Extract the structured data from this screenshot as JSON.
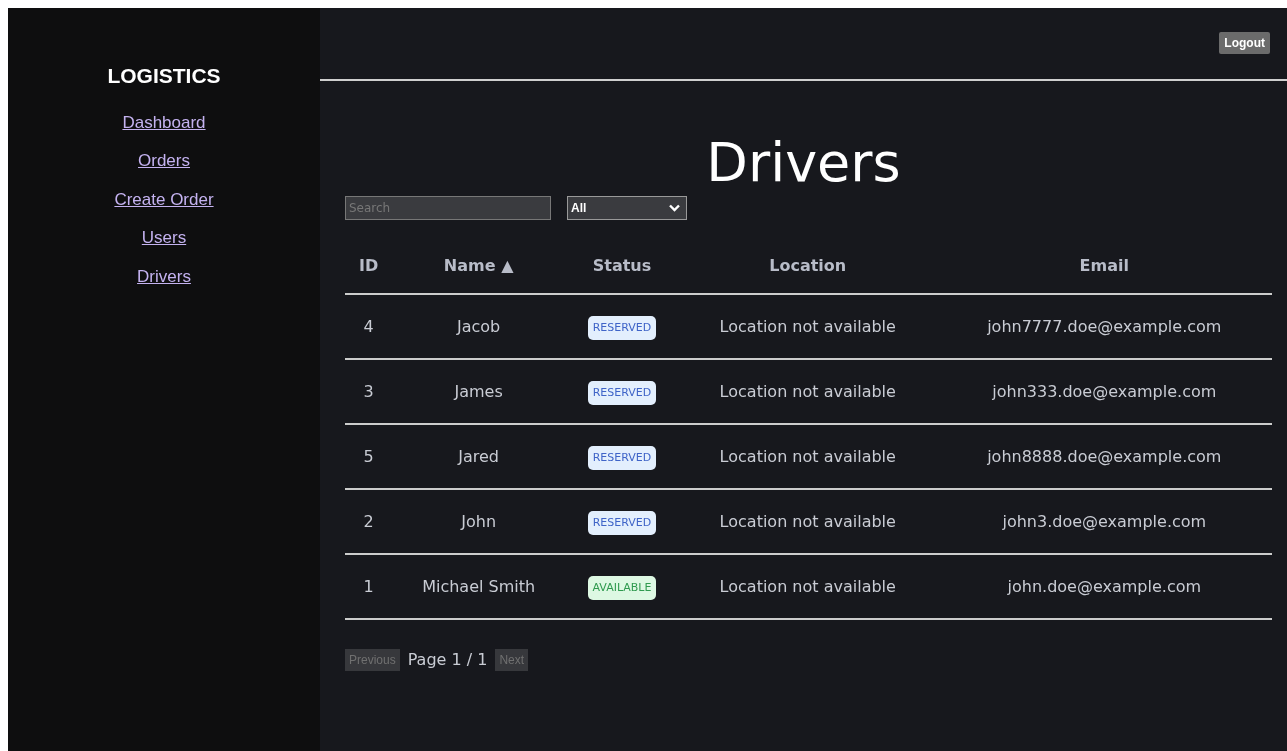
{
  "sidebar": {
    "brand": "LOGISTICS",
    "items": [
      {
        "label": "Dashboard"
      },
      {
        "label": "Orders"
      },
      {
        "label": "Create Order"
      },
      {
        "label": "Users"
      },
      {
        "label": "Drivers"
      }
    ]
  },
  "header": {
    "logout": "Logout"
  },
  "title": "Drivers",
  "filters": {
    "search": {
      "placeholder": "Search"
    },
    "status_select": {
      "value": "All"
    }
  },
  "table": {
    "columns": [
      {
        "label": "ID"
      },
      {
        "label": "Name",
        "sort": "▲"
      },
      {
        "label": "Status"
      },
      {
        "label": "Location"
      },
      {
        "label": "Email"
      }
    ],
    "rows": [
      {
        "id": "4",
        "name": "Jacob",
        "status": {
          "text": "RESERVED",
          "kind": "reserved"
        },
        "location": "Location not available",
        "email": "john7777.doe@example.com"
      },
      {
        "id": "3",
        "name": "James",
        "status": {
          "text": "RESERVED",
          "kind": "reserved"
        },
        "location": "Location not available",
        "email": "john333.doe@example.com"
      },
      {
        "id": "5",
        "name": "Jared",
        "status": {
          "text": "RESERVED",
          "kind": "reserved"
        },
        "location": "Location not available",
        "email": "john8888.doe@example.com"
      },
      {
        "id": "2",
        "name": "John",
        "status": {
          "text": "RESERVED",
          "kind": "reserved"
        },
        "location": "Location not available",
        "email": "john3.doe@example.com"
      },
      {
        "id": "1",
        "name": "Michael Smith",
        "status": {
          "text": "AVAILABLE",
          "kind": "available"
        },
        "location": "Location not available",
        "email": "john.doe@example.com"
      }
    ]
  },
  "pagination": {
    "previous": {
      "label": "Previous",
      "disabled": true
    },
    "page": "Page 1 / 1",
    "next": {
      "label": "Next",
      "disabled": true
    }
  }
}
